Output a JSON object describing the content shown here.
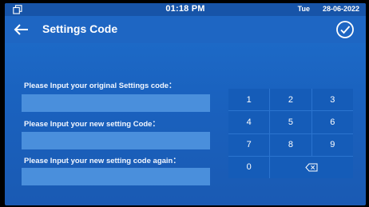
{
  "status_bar": {
    "icon": "copy-window-icon",
    "time": "01:18 PM",
    "day": "Tue",
    "date": "28-06-2022"
  },
  "header": {
    "back_icon": "arrow-left-icon",
    "title": "Settings Code",
    "confirm_icon": "check-circle-icon"
  },
  "form": {
    "fields": [
      {
        "label": "Please Input your original Settings code：",
        "value": ""
      },
      {
        "label": "Please Input your new setting Code：",
        "value": ""
      },
      {
        "label": "Please Input your new setting code again：",
        "value": ""
      }
    ]
  },
  "keypad": {
    "keys": [
      "1",
      "2",
      "3",
      "4",
      "5",
      "6",
      "7",
      "8",
      "9",
      "0"
    ],
    "backspace_icon": "backspace-icon"
  },
  "colors": {
    "background": "#1f6fcc",
    "input": "#4a8fdc",
    "key": "#155cb8"
  }
}
